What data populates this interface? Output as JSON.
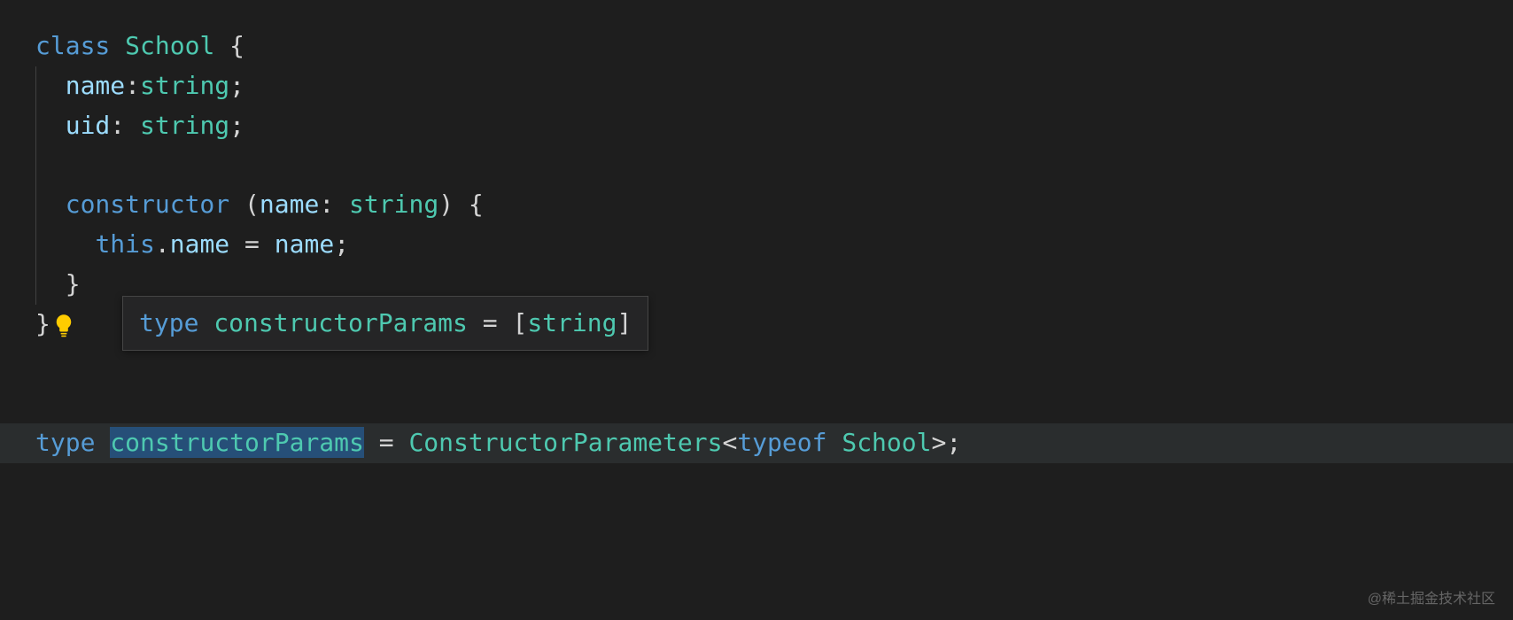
{
  "code": {
    "line1": {
      "class_kw": "class",
      "class_name": "School",
      "brace": " {"
    },
    "line2": {
      "indent": "  ",
      "prop": "name",
      "colon": ":",
      "type": "string",
      "semi": ";"
    },
    "line3": {
      "indent": "  ",
      "prop": "uid",
      "colon": ": ",
      "type": "string",
      "semi": ";"
    },
    "line5": {
      "indent": "  ",
      "ctor": "constructor",
      "open": " (",
      "param": "name",
      "colon": ": ",
      "type": "string",
      "close": ") {"
    },
    "line6": {
      "indent": "    ",
      "this_kw": "this",
      "dot": ".",
      "prop": "name",
      "eq": " = ",
      "rhs": "name",
      "semi": ";"
    },
    "line7": {
      "indent": "  ",
      "brace": "}"
    },
    "line8": {
      "brace": "}"
    },
    "line9": {
      "type_kw": "type",
      "sp1": " ",
      "alias": "constructorParams",
      "eq": " = ",
      "util": "ConstructorParameters",
      "lt": "<",
      "typeof_kw": "typeof",
      "sp2": " ",
      "target": "School",
      "gt": ">",
      "semi": ";"
    }
  },
  "tooltip": {
    "type_kw": "type",
    "sp": " ",
    "alias": "constructorParams",
    "eq": " = ",
    "open": "[",
    "member": "string",
    "close": "]"
  },
  "watermark": "@稀土掘金技术社区"
}
